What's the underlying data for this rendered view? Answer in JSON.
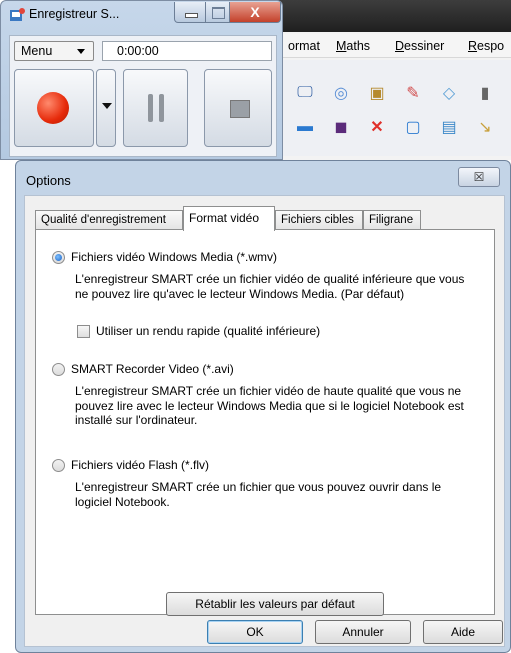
{
  "background_app": {
    "menus": [
      {
        "pre": "",
        "u": "",
        "post": "ormat"
      },
      {
        "pre": "",
        "u": "M",
        "post": "aths"
      },
      {
        "pre": "",
        "u": "D",
        "post": "essiner"
      },
      {
        "pre": "",
        "u": "R",
        "post": "espo"
      }
    ],
    "toolbar_icons_row1": [
      "monitor-icon",
      "balloon-icon",
      "clipboard-icon",
      "eraser-icon",
      "shape-icon",
      "book-icon"
    ],
    "toolbar_icons_row2": [
      "screen-icon",
      "capture-icon",
      "delete-icon",
      "page-icon",
      "window-icon",
      "arrow-icon"
    ]
  },
  "recorder": {
    "title": "Enregistreur S...",
    "menu_label": "Menu",
    "elapsed": "0:00:00",
    "close_glyph": "X",
    "record_color": "#e62a0a"
  },
  "dialog": {
    "title": "Options",
    "close_glyph": "☒",
    "tabs": [
      {
        "label": "Qualité d'enregistrement",
        "active": false
      },
      {
        "label": "Format vidéo",
        "active": true
      },
      {
        "label": "Fichiers cibles",
        "active": false
      },
      {
        "label": "Filigrane",
        "active": false
      }
    ],
    "options": {
      "wmv": {
        "label": "Fichiers vidéo Windows Media (*.wmv)",
        "description": "L'enregistreur SMART crée un fichier vidéo de qualité inférieure que vous ne pouvez lire qu'avec le lecteur Windows Media. (Par défaut)",
        "selected": true
      },
      "fast_render": {
        "label": "Utiliser un rendu rapide (qualité inférieure)",
        "checked": false
      },
      "avi": {
        "label": "SMART Recorder Video (*.avi)",
        "description": "L'enregistreur SMART crée un fichier vidéo de haute qualité que vous ne pouvez lire avec le lecteur Windows Media que si le logiciel Notebook est installé sur l'ordinateur.",
        "selected": false
      },
      "flv": {
        "label": "Fichiers vidéo Flash (*.flv)",
        "description": "L'enregistreur SMART crée un fichier que vous pouvez ouvrir dans le logiciel Notebook.",
        "selected": false
      }
    },
    "reset_label": "Rétablir les valeurs par défaut",
    "ok_label": "OK",
    "cancel_label": "Annuler",
    "help_label": "Aide"
  }
}
